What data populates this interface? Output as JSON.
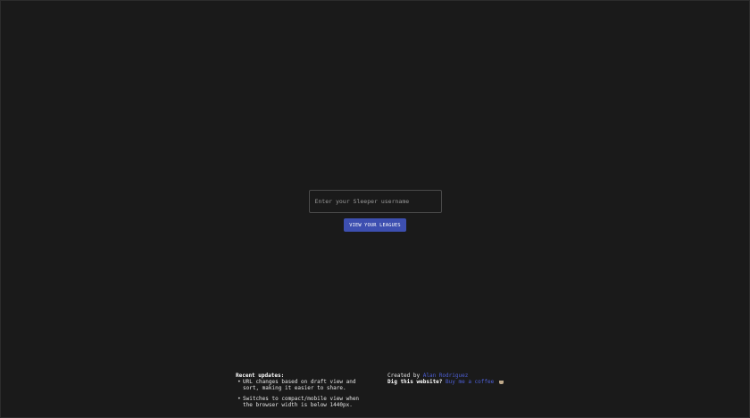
{
  "login": {
    "placeholder": "Enter your Sleeper username",
    "submit_label": "VIEW YOUR LEAGUES"
  },
  "footer": {
    "updates_title": "Recent updates:",
    "updates": [
      "URL changes based on draft view and sort, making it easier to share.",
      "Switches to compact/mobile view when the browser width is below 1440px."
    ],
    "created_by_label": "Created by",
    "author_name": "Alan Rodriguez",
    "dig_label": "Dig this website?",
    "coffee_link": "Buy me a coffee",
    "coffee_icon": "coffee-icon"
  },
  "colors": {
    "background": "#1a1a1a",
    "accent": "#3d4fb0",
    "link": "#4d5fd6"
  }
}
